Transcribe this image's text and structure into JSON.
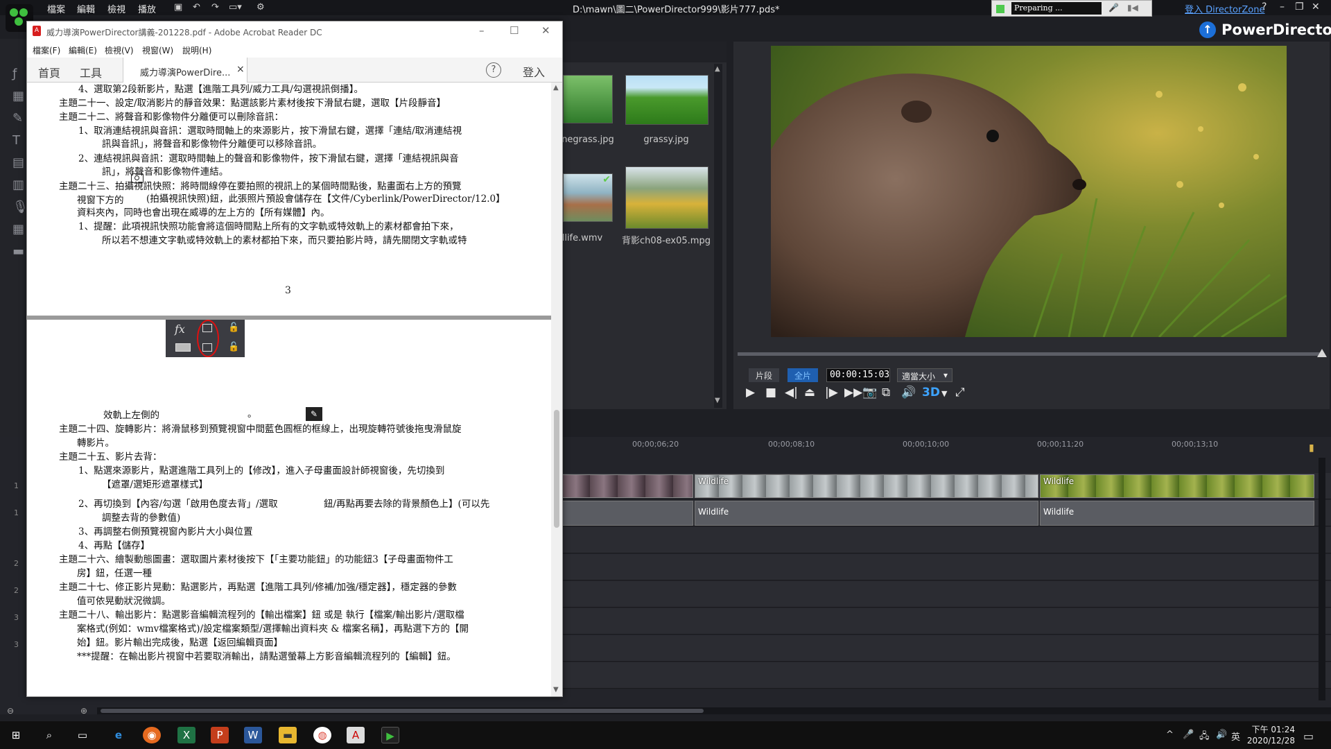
{
  "pd": {
    "menu": [
      "檔案",
      "編輯",
      "檢視",
      "播放"
    ],
    "window_title": "D:\\mawn\\圖二\\PowerDirector999\\影片777.pds*",
    "preparing_text": "Preparing ...",
    "login_link": "登入 DirectorZone",
    "help": "?",
    "brand": "PowerDirector",
    "library": {
      "items": [
        {
          "label": "negrass.jpg",
          "icon": "grass-girl"
        },
        {
          "label": "grassy.jpg",
          "icon": "grass-field"
        },
        {
          "label": "llife.wmv",
          "icon": "horses"
        },
        {
          "label": "背影ch08-ex05.mpg",
          "icon": "walking-field"
        }
      ]
    },
    "preview": {
      "mode_clip": "片段",
      "mode_movie": "全片",
      "timecode": "00:00:15:03",
      "zoom": "適當大小",
      "threeD": "3D"
    },
    "timeline": {
      "ruler": [
        "00;00;06;20",
        "00;00;08;10",
        "00;00;10;00",
        "00;00;11;20",
        "00;00;13;10"
      ],
      "video_clips": [
        "Wildlife",
        "Wildlife"
      ],
      "audio_clips": [
        "Wildlife",
        "Wildlife"
      ],
      "track_nums": [
        "1",
        "1",
        "2",
        "2",
        "3",
        "3"
      ]
    }
  },
  "acrobat": {
    "title": "威力導演PowerDirector講義-201228.pdf - Adobe Acrobat Reader DC",
    "menu": [
      "檔案(F)",
      "編輯(E)",
      "檢視(V)",
      "視窗(W)",
      "說明(H)"
    ],
    "tabs": {
      "home": "首頁",
      "tools": "工具",
      "doc": "威力導演PowerDire...",
      "close": "×",
      "help": "?",
      "signin": "登入"
    },
    "page1": [
      "4、選取第2段新影片，點選【進階工具列/威力工具/勾選視訊倒播】。",
      "主題二十一、設定/取消影片的靜音效果：點選該影片素材後按下滑鼠右鍵，選取【片段靜音】",
      "主題二十二、將聲音和影像物件分離便可以刪除音訊：",
      "1、取消連結視訊與音訊：選取時間軸上的來源影片，按下滑鼠右鍵，選擇「連結/取消連結視",
      "訊與音訊」，將聲音和影像物件分離便可以移除音訊。",
      "2、連結視訊與音訊：選取時間軸上的聲音和影像物件，按下滑鼠右鍵，選擇「連結視訊與音",
      "訊」，將聲音和影像物件連結。",
      "主題二十三、拍攝視訊快照：將時間線停在要拍照的視訊上的某個時間點後，點畫面右上方的預覽",
      "視窗下方的",
      "(拍攝視訊快照)鈕，此張照片預設會儲存在【文件/Cyberlink/PowerDirector/12.0】",
      "資料夾內，同時也會出現在威導的左上方的【所有媒體】內。",
      "1、提醒：此項視訊快照功能會將這個時間點上所有的文字軌或特效軌上的素材都會拍下來，",
      "所以若不想連文字軌或特效軌上的素材都拍下來，而只要拍影片時，請先關閉文字軌或特"
    ],
    "page_number": "3",
    "page2": [
      "效軌上左側的",
      "。",
      "主題二十四、旋轉影片：將滑鼠移到預覽視窗中間藍色圓框的框線上，出現旋轉符號後拖曳滑鼠旋",
      "轉影片。",
      "主題二十五、影片去背：",
      "1、點選來源影片，點選進階工具列上的【修改】，進入子母畫面設計師視窗後，先切換到",
      "【遮罩/選矩形遮罩樣式】",
      "2、再切換到【內容/勾選「啟用色度去背」/選取",
      "鈕/再點再要去除的背景顏色上】(可以先",
      "調整去背的參數值)",
      "3、再調整右側預覽視窗內影片大小與位置",
      "4、再點【儲存】",
      "主題二十六、繪製動態圖畫：選取圖片素材後按下【「主要功能鈕」的功能鈕3【子母畫面物件工",
      "房】鈕，任選一種",
      "主題二十七、修正影片晃動：點選影片，再點選【進階工具列/修補/加強/穩定器】，穩定器的參數",
      "值可依晃動狀況微調。",
      "主題二十八、輸出影片：點選影音編輯流程列的【輸出檔案】鈕 或是 執行【檔案/輸出影片/選取檔",
      "案格式(例如：wmv檔案格式)/設定檔案類型/選擇輸出資料夾 & 檔案名稱】，再點選下方的【開",
      "始】鈕。影片輸出完成後，點選【返回編輯頁面】",
      "***提醒：在輸出影片視窗中若要取消輸出，請點選螢幕上方影音編輯流程列的【編輯】鈕。"
    ],
    "track_icon_fx": "fx"
  },
  "taskbar": {
    "clock_time": "下午 01:24",
    "clock_date": "2020/12/28",
    "ime": "英"
  }
}
